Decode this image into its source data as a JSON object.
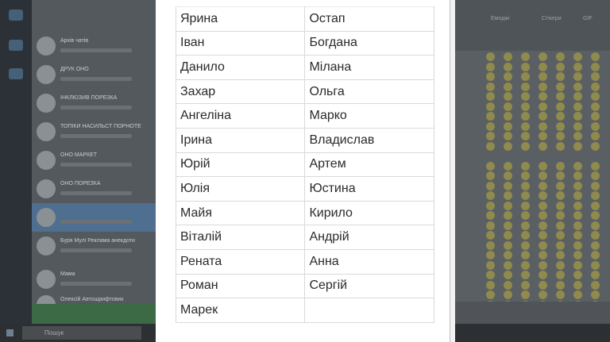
{
  "background": {
    "chats": [
      {
        "title": "Архів чатів"
      },
      {
        "title": "ДРУК ОНО"
      },
      {
        "title": "ІНКЛЮЗИВ ПОРЕЗКА"
      },
      {
        "title": "ТОПІКИ НАСИЛЬСТ ПОРНОТЕ"
      },
      {
        "title": "ОНО МАРКЕТ"
      },
      {
        "title": "ОНО ПОРЕЗКА"
      },
      {
        "title": ""
      },
      {
        "title": "Буря Мулі Реклама анекдоти"
      },
      {
        "title": "Мама"
      },
      {
        "title": "Олексій Автошрифтовик"
      }
    ],
    "search_placeholder": "Пошук",
    "right_tabs": [
      "Емоджі",
      "Стікери",
      "GIF"
    ]
  },
  "names_table": {
    "rows": [
      [
        "Ярина",
        "Остап"
      ],
      [
        "Іван",
        "Богдана"
      ],
      [
        "Данило",
        "Мілана"
      ],
      [
        "Захар",
        "Ольга"
      ],
      [
        "Ангеліна",
        "Марко"
      ],
      [
        "Ірина",
        "Владислав"
      ],
      [
        "Юрій",
        "Артем"
      ],
      [
        "Юлія",
        "Юстина"
      ],
      [
        "Майя",
        "Кирило"
      ],
      [
        "Віталій",
        "Андрій"
      ],
      [
        "Рената",
        "Анна"
      ],
      [
        "Роман",
        "Сергій"
      ],
      [
        "Марек",
        ""
      ]
    ]
  }
}
